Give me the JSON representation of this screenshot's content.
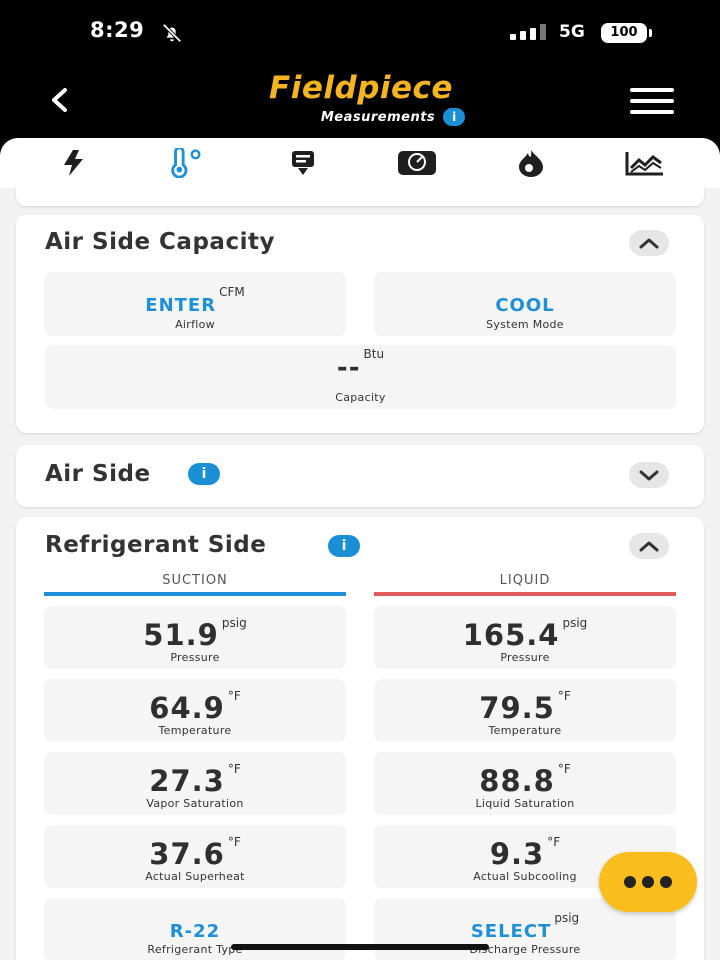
{
  "status": {
    "time": "8:29",
    "network": "5G",
    "battery": "100"
  },
  "header": {
    "logo": "Fieldpiece",
    "subtitle": "Measurements",
    "info": "i"
  },
  "tabs": [
    {
      "icon": "lightning-icon"
    },
    {
      "icon": "thermometer-icon"
    },
    {
      "icon": "download-card-icon"
    },
    {
      "icon": "gauge-icon"
    },
    {
      "icon": "flame-icon"
    },
    {
      "icon": "chart-icon"
    }
  ],
  "air_side_capacity": {
    "title": "Air Side Capacity",
    "airflow": {
      "value": "ENTER",
      "unit": "CFM",
      "label": "Airflow"
    },
    "system_mode": {
      "value": "COOL",
      "label": "System Mode"
    },
    "capacity": {
      "value": "--",
      "unit": "Btu",
      "label": "Capacity"
    }
  },
  "air_side": {
    "title": "Air Side",
    "info": "i"
  },
  "refrigerant_side": {
    "title": "Refrigerant Side",
    "info": "i",
    "suction_header": "SUCTION",
    "liquid_header": "LIQUID",
    "suction_color": "#1e8fd8",
    "liquid_color": "#e25b5b",
    "suction": [
      {
        "value": "51.9",
        "unit": "psig",
        "label": "Pressure"
      },
      {
        "value": "64.9",
        "unit": "°F",
        "label": "Temperature"
      },
      {
        "value": "27.3",
        "unit": "°F",
        "label": "Vapor Saturation"
      },
      {
        "value": "37.6",
        "unit": "°F",
        "label": "Actual Superheat"
      },
      {
        "value": "R-22",
        "unit": "",
        "label": "Refrigerant Type"
      }
    ],
    "liquid": [
      {
        "value": "165.4",
        "unit": "psig",
        "label": "Pressure"
      },
      {
        "value": "79.5",
        "unit": "°F",
        "label": "Temperature"
      },
      {
        "value": "88.8",
        "unit": "°F",
        "label": "Liquid Saturation"
      },
      {
        "value": "9.3",
        "unit": "°F",
        "label": "Actual Subcooling"
      },
      {
        "value": "SELECT",
        "unit": "psig",
        "label": "Discharge Pressure"
      }
    ]
  },
  "colors": {
    "brand": "#f6b51e",
    "accent": "#1e8fd8",
    "fab": "#f9be1e"
  }
}
